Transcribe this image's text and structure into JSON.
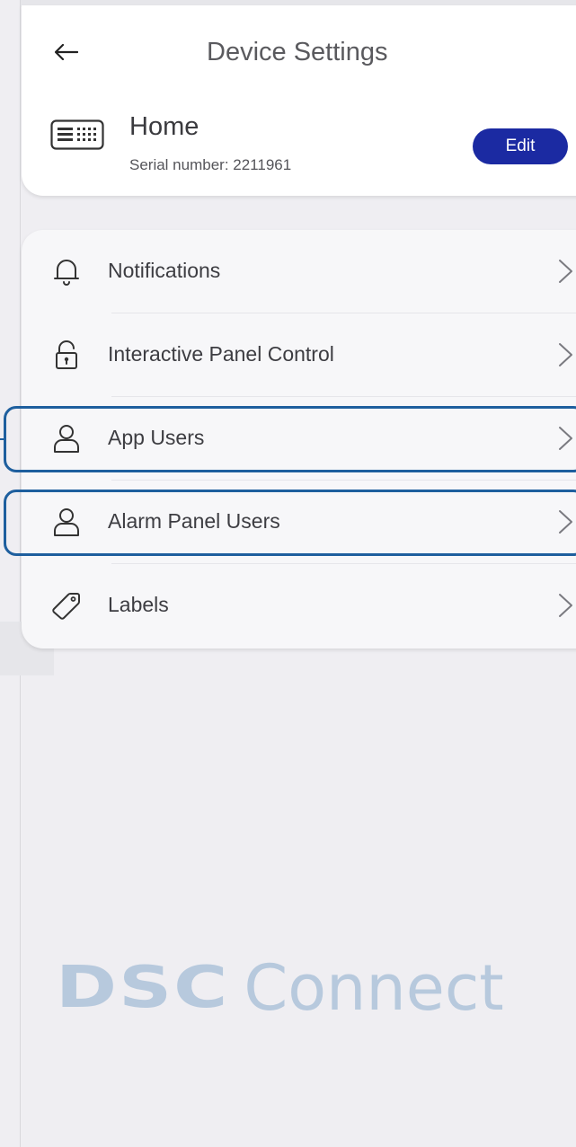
{
  "header": {
    "title": "Device Settings",
    "back_icon": "arrow-left-icon"
  },
  "device": {
    "name": "Home",
    "serial": "Serial number: 2211961",
    "icon": "keypad-icon",
    "edit_label": "Edit"
  },
  "menu": {
    "items": [
      {
        "label": "Notifications",
        "icon": "bell-icon"
      },
      {
        "label": "Interactive Panel Control",
        "icon": "lock-icon"
      },
      {
        "label": "App Users",
        "icon": "user-icon"
      },
      {
        "label": "Alarm Panel Users",
        "icon": "user-icon"
      },
      {
        "label": "Labels",
        "icon": "tag-icon"
      }
    ]
  },
  "branding": {
    "logo_text": "DSC",
    "product_text": "Connect"
  },
  "colors": {
    "accent": "#1b2aa2",
    "highlight": "#1e5f9e",
    "background": "#efeef2",
    "brand": "#b7c9dd"
  }
}
